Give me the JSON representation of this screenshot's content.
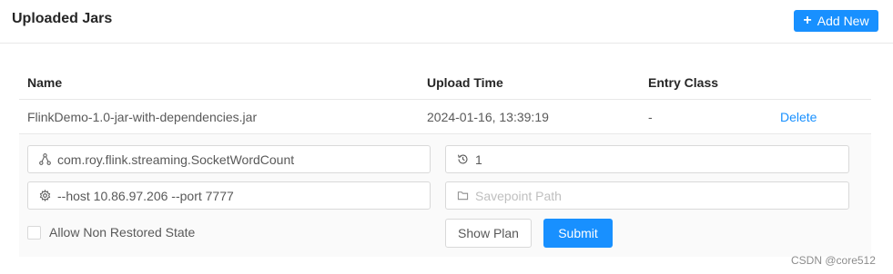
{
  "header": {
    "title": "Uploaded Jars",
    "add_label": "Add New"
  },
  "table": {
    "columns": [
      "Name",
      "Upload Time",
      "Entry Class",
      ""
    ],
    "rows": [
      {
        "name": "FlinkDemo-1.0-jar-with-dependencies.jar",
        "upload_time": "2024-01-16, 13:39:19",
        "entry_class": "-",
        "action": "Delete"
      }
    ]
  },
  "form": {
    "entry_class_value": "com.roy.flink.streaming.SocketWordCount",
    "parallelism_value": "1",
    "program_args_value": "--host 10.86.97.206 --port 7777",
    "savepoint_placeholder": "Savepoint Path",
    "allow_non_restored_label": "Allow Non Restored State",
    "show_plan_label": "Show Plan",
    "submit_label": "Submit"
  },
  "watermark": "CSDN @core512",
  "colors": {
    "primary": "#1890ff",
    "border": "#d9d9d9",
    "panel_bg": "#fafafa"
  }
}
